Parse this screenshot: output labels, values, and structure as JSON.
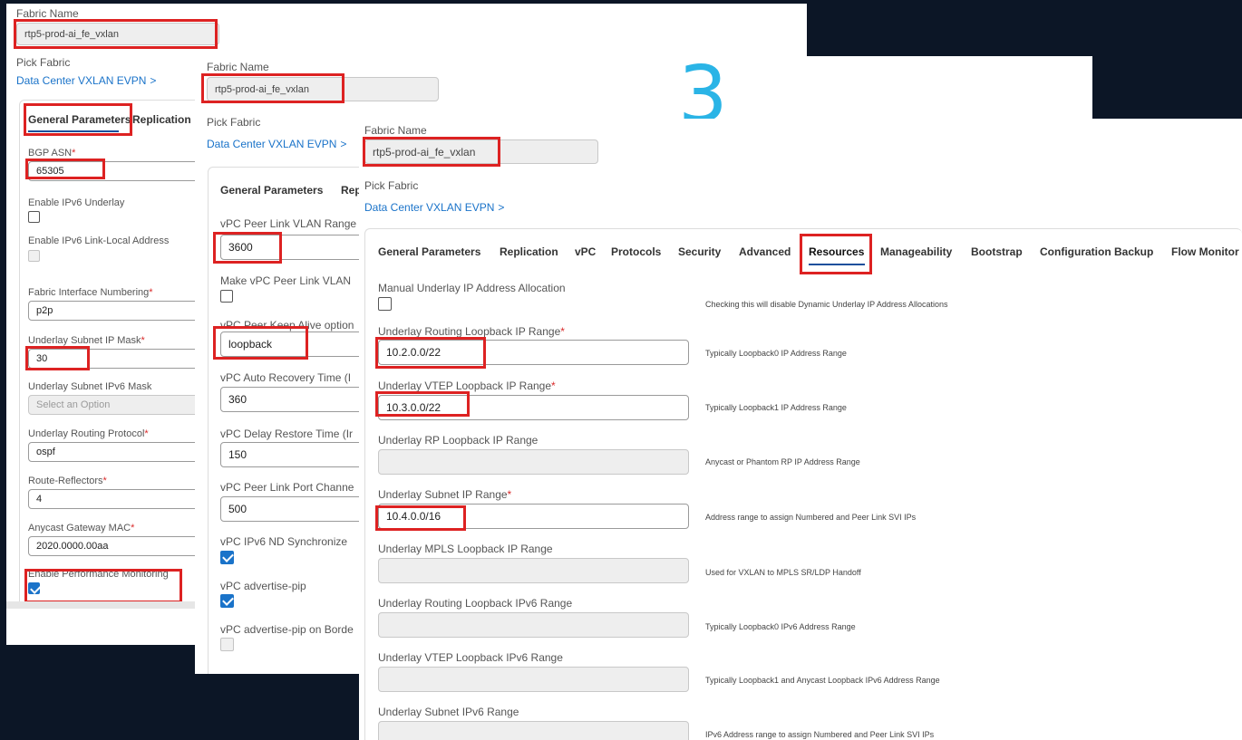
{
  "common": {
    "fabric_name_label": "Fabric Name",
    "fabric_name_value": "rtp5-prod-ai_fe_vxlan",
    "pick_fabric_label": "Pick Fabric",
    "fabric_type_link": "Data Center VXLAN EVPN",
    "chevron": ">"
  },
  "step_number": "3",
  "panel1": {
    "tabs": [
      "General Parameters",
      "Replication"
    ],
    "fields": {
      "bgp_asn_label": "BGP ASN",
      "bgp_asn_value": "65305",
      "ipv6_underlay_label": "Enable IPv6 Underlay",
      "ipv6_link_local_label": "Enable IPv6 Link-Local Address",
      "fabric_if_numbering_label": "Fabric Interface Numbering",
      "fabric_if_numbering_value": "p2p",
      "underlay_subnet_mask_label": "Underlay Subnet IP Mask",
      "underlay_subnet_mask_value": "30",
      "underlay_subnet_v6_mask_label": "Underlay Subnet IPv6 Mask",
      "underlay_subnet_v6_mask_placeholder": "Select an Option",
      "routing_protocol_label": "Underlay Routing Protocol",
      "routing_protocol_value": "ospf",
      "route_reflectors_label": "Route-Reflectors",
      "route_reflectors_value": "4",
      "anycast_mac_label": "Anycast Gateway MAC",
      "anycast_mac_value": "2020.0000.00aa",
      "perf_monitoring_label": "Enable Performance Monitoring"
    }
  },
  "panel2": {
    "tabs": [
      "General Parameters",
      "Rep"
    ],
    "fields": {
      "peer_link_vlan_label": "vPC Peer Link VLAN Range",
      "peer_link_vlan_value": "3600",
      "make_peer_link_label": "Make vPC Peer Link VLAN",
      "keepalive_label": "vPC Peer Keep Alive option",
      "keepalive_value": "loopback",
      "auto_recovery_label": "vPC Auto Recovery Time (I",
      "auto_recovery_value": "360",
      "delay_restore_label": "vPC Delay Restore Time (Ir",
      "delay_restore_value": "150",
      "port_channel_label": "vPC Peer Link Port Channe",
      "port_channel_value": "500",
      "nd_sync_label": "vPC IPv6 ND Synchronize",
      "advertise_pip_label": "vPC advertise-pip",
      "advertise_pip_border_label": "vPC advertise-pip on Borde"
    }
  },
  "panel3": {
    "tabs": [
      "General Parameters",
      "Replication",
      "vPC",
      "Protocols",
      "Security",
      "Advanced",
      "Resources",
      "Manageability",
      "Bootstrap",
      "Configuration Backup",
      "Flow Monitor"
    ],
    "manual_alloc_label": "Manual Underlay IP Address Allocation",
    "manual_alloc_help": "Checking this will disable Dynamic Underlay IP Address Allocations",
    "ranges": [
      {
        "label": "Underlay Routing Loopback IP Range",
        "required": true,
        "value": "10.2.0.0/22",
        "help": "Typically Loopback0 IP Address Range"
      },
      {
        "label": "Underlay VTEP Loopback IP Range",
        "required": true,
        "value": "10.3.0.0/22",
        "help": "Typically Loopback1 IP Address Range"
      },
      {
        "label": "Underlay RP Loopback IP Range",
        "required": false,
        "value": "",
        "help": "Anycast or Phantom RP IP Address Range"
      },
      {
        "label": "Underlay Subnet IP Range",
        "required": true,
        "value": "10.4.0.0/16",
        "help": "Address range to assign Numbered and Peer Link SVI IPs"
      },
      {
        "label": "Underlay MPLS Loopback IP Range",
        "required": false,
        "value": "",
        "help": "Used for VXLAN to MPLS SR/LDP Handoff"
      },
      {
        "label": "Underlay Routing Loopback IPv6 Range",
        "required": false,
        "value": "",
        "help": "Typically Loopback0 IPv6 Address Range"
      },
      {
        "label": "Underlay VTEP Loopback IPv6 Range",
        "required": false,
        "value": "",
        "help": "Typically Loopback1 and Anycast Loopback IPv6 Address Range"
      },
      {
        "label": "Underlay Subnet IPv6 Range",
        "required": false,
        "value": "",
        "help": "IPv6 Address range to assign Numbered and Peer Link SVI IPs"
      }
    ]
  },
  "colors": {
    "highlight": "#dd2222",
    "link": "#1a73c9",
    "step_number": "#2ab4e6",
    "background": "#0c1626"
  }
}
